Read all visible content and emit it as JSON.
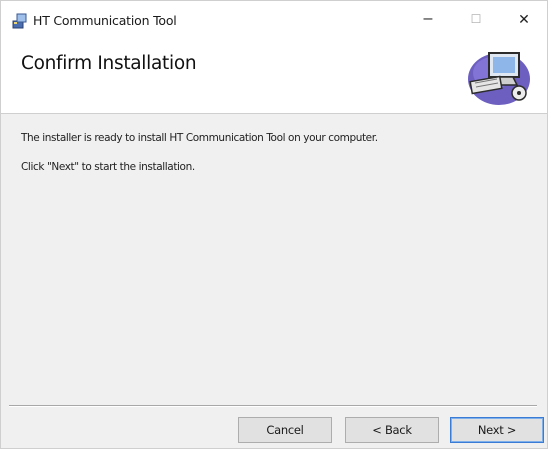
{
  "window": {
    "title": "HT Communication Tool",
    "controls": {
      "minimize": "–",
      "maximize": "☐",
      "close": "✕"
    }
  },
  "header": {
    "title": "Confirm Installation",
    "graphic_icon": "computer-install-graphic"
  },
  "content": {
    "message": "The installer is ready to install HT Communication Tool on your computer.",
    "instruction": "Click \"Next\" to start the installation."
  },
  "buttons": {
    "cancel": "Cancel",
    "back": "< Back",
    "next": "Next >"
  },
  "colors": {
    "dialog_bg": "#f0f0f0",
    "header_bg": "#ffffff",
    "default_button_border": "#3a7bd5"
  }
}
